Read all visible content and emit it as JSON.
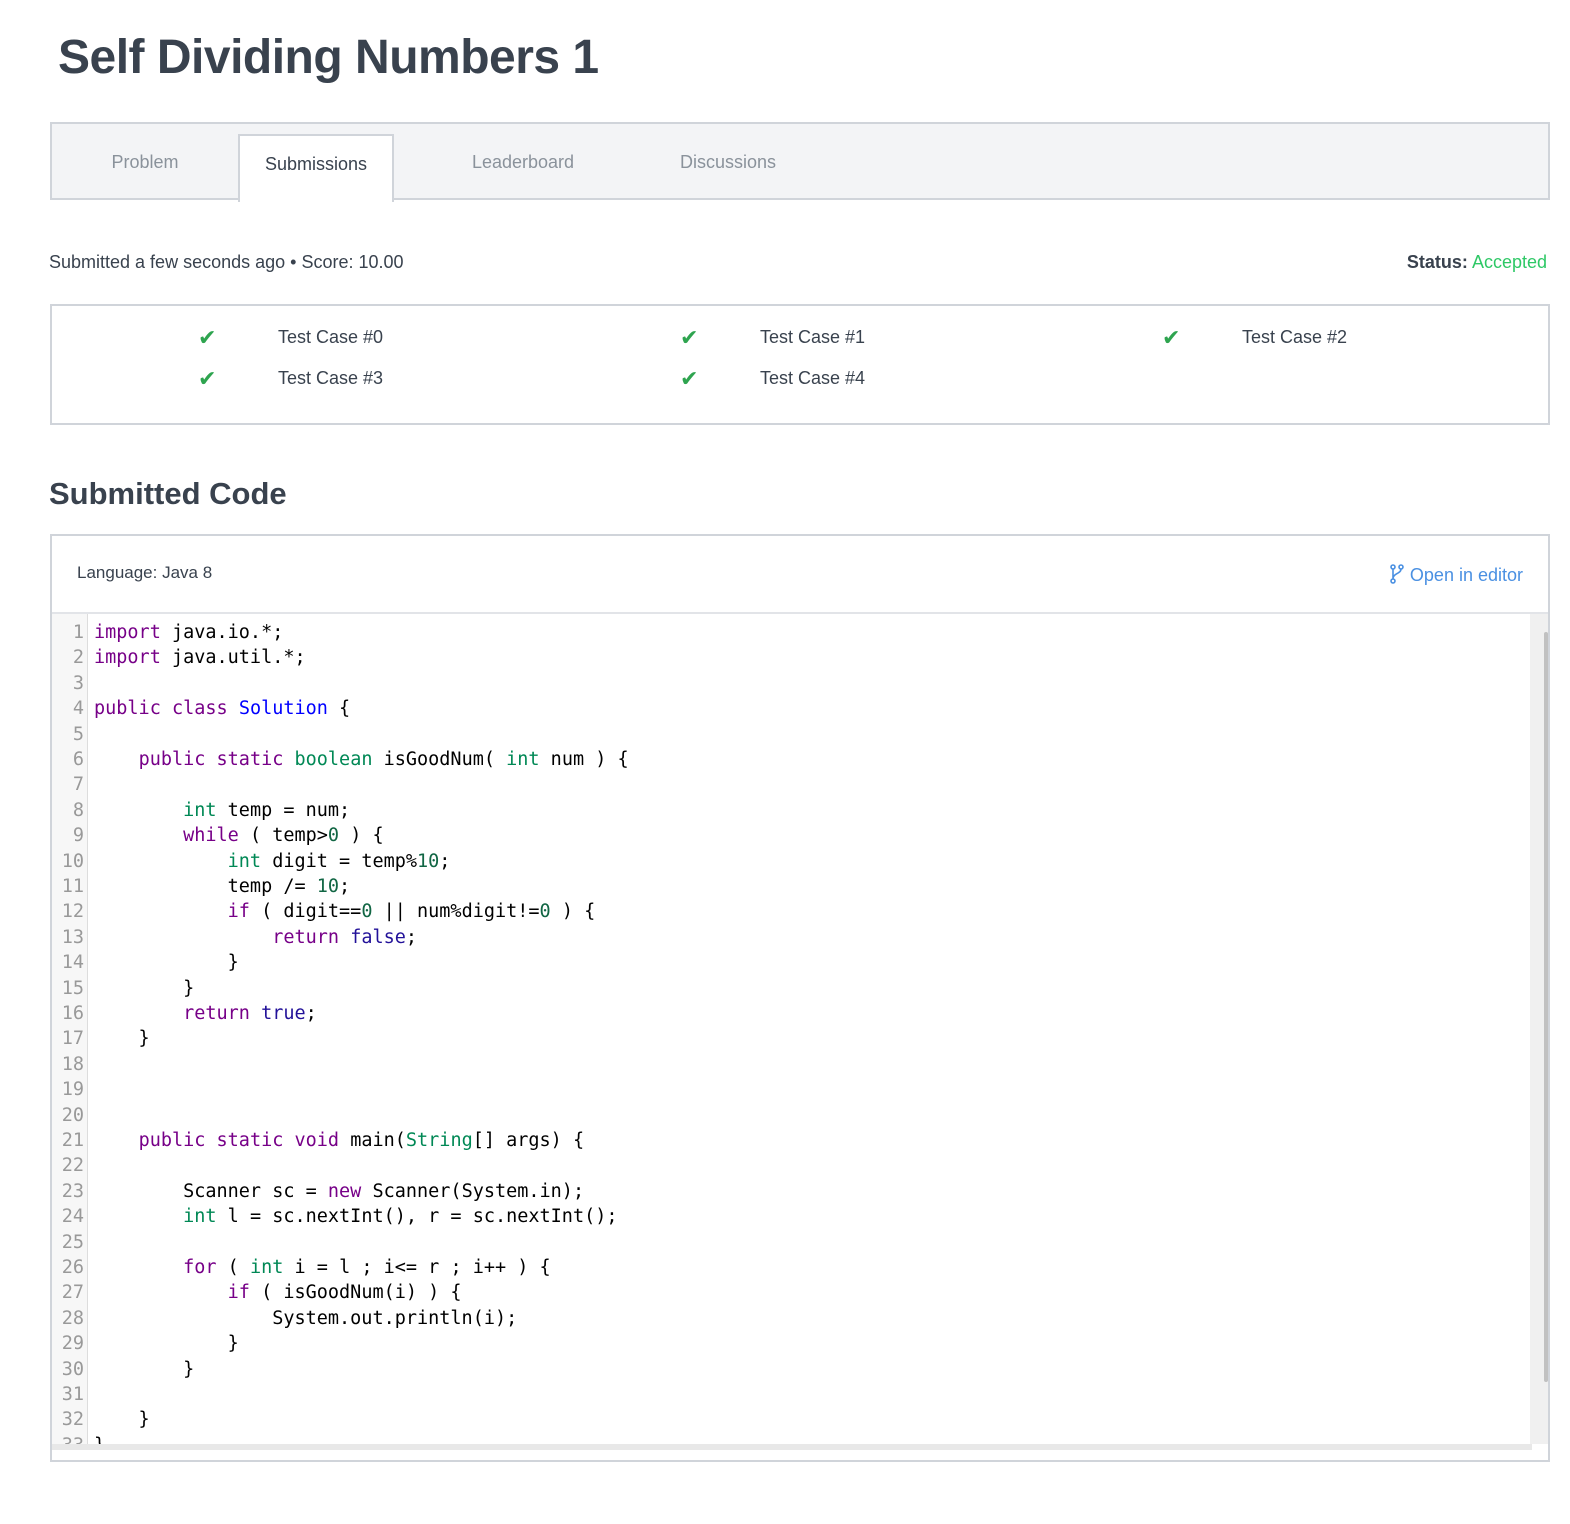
{
  "title": "Self Dividing Numbers 1",
  "tabs": [
    {
      "label": "Problem",
      "active": false
    },
    {
      "label": "Submissions",
      "active": true
    },
    {
      "label": "Leaderboard",
      "active": false
    },
    {
      "label": "Discussions",
      "active": false
    }
  ],
  "submission": {
    "meta": "Submitted a few seconds ago • Score: 10.00",
    "status_label": "Status:",
    "status_value": "Accepted",
    "status_color": "#2ec866"
  },
  "test_cases": [
    {
      "label": "Test Case #0",
      "passed": true
    },
    {
      "label": "Test Case #1",
      "passed": true
    },
    {
      "label": "Test Case #2",
      "passed": true
    },
    {
      "label": "Test Case #3",
      "passed": true
    },
    {
      "label": "Test Case #4",
      "passed": true
    }
  ],
  "code_section": {
    "heading": "Submitted Code",
    "language": "Language: Java 8",
    "open_editor": "Open in editor",
    "open_editor_icon": "branch-icon"
  },
  "code": [
    [
      [
        "kw",
        "import"
      ],
      [
        "",
        " java.io.*;"
      ]
    ],
    [
      [
        "kw",
        "import"
      ],
      [
        "",
        " java.util.*;"
      ]
    ],
    [],
    [
      [
        "kw",
        "public"
      ],
      [
        "",
        " "
      ],
      [
        "kw",
        "class"
      ],
      [
        "",
        " "
      ],
      [
        "df",
        "Solution"
      ],
      [
        "",
        " {"
      ]
    ],
    [],
    [
      [
        "",
        "    "
      ],
      [
        "kw",
        "public"
      ],
      [
        "",
        " "
      ],
      [
        "kw",
        "static"
      ],
      [
        "",
        " "
      ],
      [
        "ty",
        "boolean"
      ],
      [
        "",
        " isGoodNum( "
      ],
      [
        "ty",
        "int"
      ],
      [
        "",
        " num ) {"
      ]
    ],
    [],
    [
      [
        "",
        "        "
      ],
      [
        "ty",
        "int"
      ],
      [
        "",
        " temp = num;"
      ]
    ],
    [
      [
        "",
        "        "
      ],
      [
        "kw",
        "while"
      ],
      [
        "",
        " ( temp>"
      ],
      [
        "nm",
        "0"
      ],
      [
        "",
        " ) {"
      ]
    ],
    [
      [
        "",
        "            "
      ],
      [
        "ty",
        "int"
      ],
      [
        "",
        " digit = temp%"
      ],
      [
        "nm",
        "10"
      ],
      [
        "",
        ";"
      ]
    ],
    [
      [
        "",
        "            temp /= "
      ],
      [
        "nm",
        "10"
      ],
      [
        "",
        ";"
      ]
    ],
    [
      [
        "",
        "            "
      ],
      [
        "kw",
        "if"
      ],
      [
        "",
        " ( digit=="
      ],
      [
        "nm",
        "0"
      ],
      [
        "",
        " || num%digit!="
      ],
      [
        "nm",
        "0"
      ],
      [
        "",
        " ) {"
      ]
    ],
    [
      [
        "",
        "                "
      ],
      [
        "kw",
        "return"
      ],
      [
        "",
        " "
      ],
      [
        "at",
        "false"
      ],
      [
        "",
        ";"
      ]
    ],
    [
      [
        "",
        "            }"
      ]
    ],
    [
      [
        "",
        "        }"
      ]
    ],
    [
      [
        "",
        "        "
      ],
      [
        "kw",
        "return"
      ],
      [
        "",
        " "
      ],
      [
        "at",
        "true"
      ],
      [
        "",
        ";"
      ]
    ],
    [
      [
        "",
        "    }"
      ]
    ],
    [],
    [],
    [],
    [
      [
        "",
        "    "
      ],
      [
        "kw",
        "public"
      ],
      [
        "",
        " "
      ],
      [
        "kw",
        "static"
      ],
      [
        "",
        " "
      ],
      [
        "kw",
        "void"
      ],
      [
        "",
        " main("
      ],
      [
        "ty",
        "String"
      ],
      [
        "",
        "[] args) {"
      ]
    ],
    [],
    [
      [
        "",
        "        Scanner sc = "
      ],
      [
        "kw",
        "new"
      ],
      [
        "",
        " Scanner(System.in);"
      ]
    ],
    [
      [
        "",
        "        "
      ],
      [
        "ty",
        "int"
      ],
      [
        "",
        " l = sc.nextInt(), r = sc.nextInt();"
      ]
    ],
    [],
    [
      [
        "",
        "        "
      ],
      [
        "kw",
        "for"
      ],
      [
        "",
        " ( "
      ],
      [
        "ty",
        "int"
      ],
      [
        "",
        " i = l ; i<= r ; i++ ) {"
      ]
    ],
    [
      [
        "",
        "            "
      ],
      [
        "kw",
        "if"
      ],
      [
        "",
        " ( isGoodNum(i) ) {"
      ]
    ],
    [
      [
        "",
        "                System.out.println(i);"
      ]
    ],
    [
      [
        "",
        "            }"
      ]
    ],
    [
      [
        "",
        "        }"
      ]
    ],
    [],
    [
      [
        "",
        "    }"
      ]
    ],
    [
      [
        "",
        "}"
      ]
    ]
  ]
}
